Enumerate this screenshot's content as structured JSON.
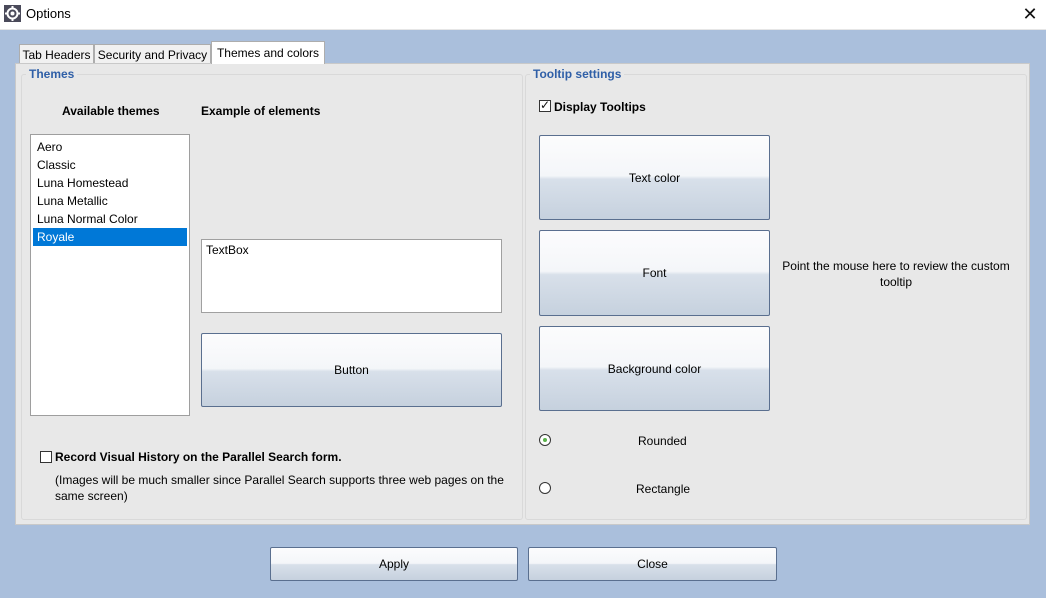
{
  "window": {
    "title": "Options"
  },
  "tabs": [
    "Tab Headers",
    "Security and Privacy",
    "Themes and colors"
  ],
  "themes": {
    "group_title": "Themes",
    "available_label": "Available themes",
    "example_label": "Example of elements",
    "items": [
      "Aero",
      "Classic",
      "Luna Homestead",
      "Luna Metallic",
      "Luna Normal Color",
      "Royale"
    ],
    "selected": "Royale",
    "textbox_value": "TextBox",
    "button_label": "Button",
    "record_history_label": "Record Visual History on the Parallel Search form.",
    "record_history_note": "(Images will be much smaller since Parallel Search supports three web pages on the same screen)"
  },
  "tooltip": {
    "group_title": "Tooltip settings",
    "display_label": "Display Tooltips",
    "text_color_button": "Text color",
    "font_button": "Font",
    "background_color_button": "Background color",
    "preview_text": "Point the mouse here to review the custom tooltip",
    "rounded_label": "Rounded",
    "rectangle_label": "Rectangle"
  },
  "footer": {
    "apply_label": "Apply",
    "close_label": "Close"
  },
  "colors": {
    "accent": "#2f5fa7",
    "selection": "#0078d7",
    "background": "#aabfdc"
  }
}
